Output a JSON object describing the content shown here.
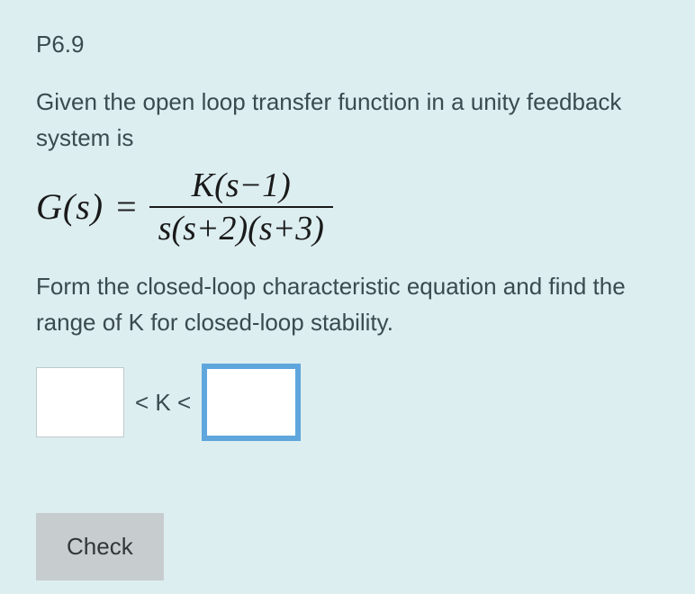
{
  "problem_id": "P6.9",
  "intro": "Given the open loop transfer function in a unity feedback system is",
  "equation": {
    "lhs": "G(s)",
    "numerator": "K(s−1)",
    "denominator": "s(s+2)(s+3)"
  },
  "task": "Form the closed-loop characteristic equation and find the range of K for closed-loop stability.",
  "inputs": {
    "lower_value": "",
    "upper_value": "",
    "between_label": "< K <"
  },
  "check_label": "Check"
}
